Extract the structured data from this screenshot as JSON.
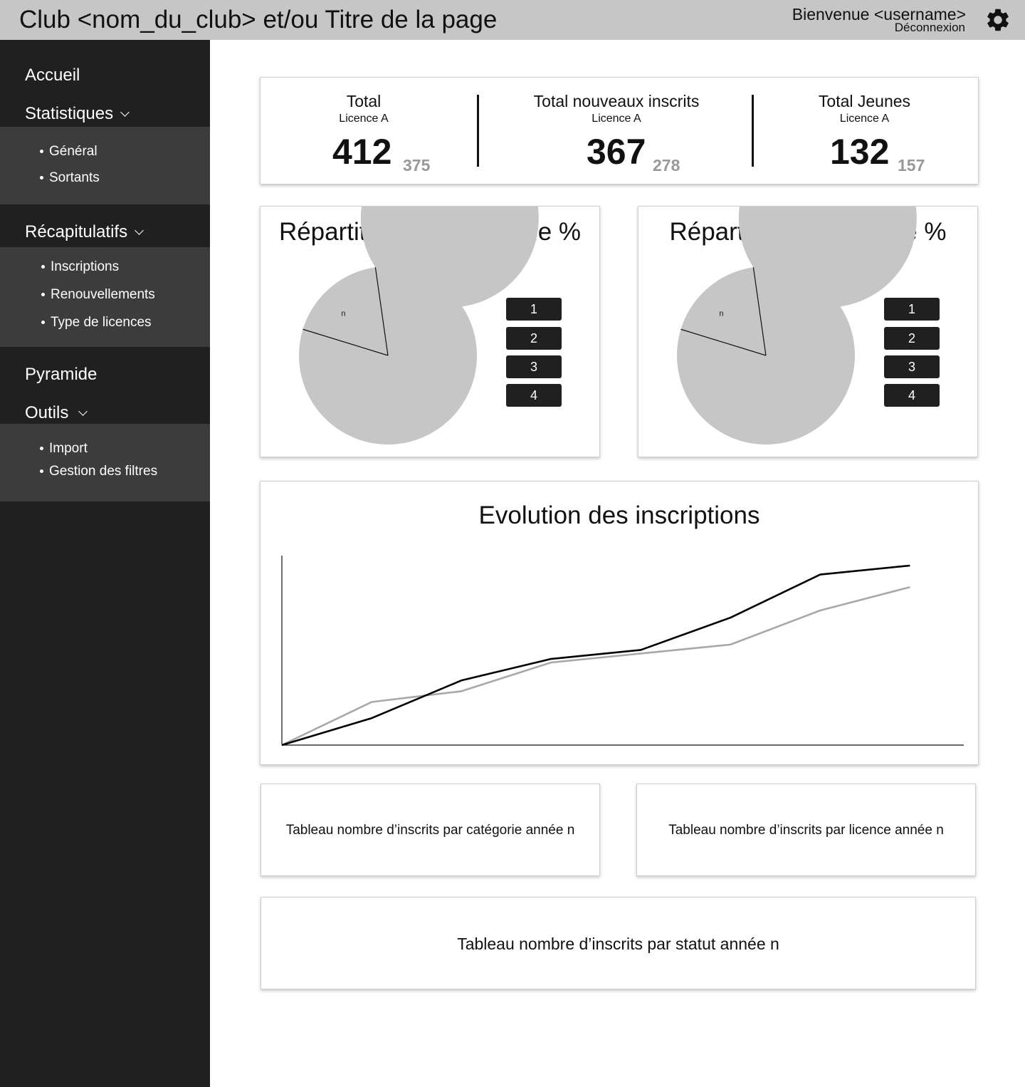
{
  "header": {
    "title": "Club <nom_du_club> et/ou Titre de la page",
    "welcome": "Bienvenue <username>",
    "logout": "Déconnexion",
    "settings_icon": "gear-icon"
  },
  "sidebar": {
    "home": "Accueil",
    "stats": {
      "label": "Statistiques",
      "items": [
        "Général",
        "Sortants"
      ]
    },
    "recaps": {
      "label": "Récapitulatifs",
      "items": [
        "Inscriptions",
        "Renouvellements",
        "Type de licences"
      ]
    },
    "pyramid": "Pyramide",
    "tools": {
      "label": "Outils",
      "items": [
        "Import",
        "Gestion des filtres"
      ]
    }
  },
  "kpis": [
    {
      "title": "Total",
      "subtitle": "Licence A",
      "value": "412",
      "previous": "375"
    },
    {
      "title": "Total nouveaux inscrits",
      "subtitle": "Licence A",
      "value": "367",
      "previous": "278"
    },
    {
      "title": "Total Jeunes",
      "subtitle": "Licence A",
      "value": "132",
      "previous": "157"
    }
  ],
  "pie_charts": [
    {
      "title": "Répartition par catégorie %",
      "slice_label": "n",
      "legend": [
        "1",
        "2",
        "3",
        "4"
      ]
    },
    {
      "title": "Répartition par licence %",
      "slice_label": "n",
      "legend": [
        "1",
        "2",
        "3",
        "4"
      ]
    }
  ],
  "colors": {
    "sidebar_bg": "#202020",
    "submenu_bg": "#3c3c3c",
    "topbar_bg": "#c6c6c6",
    "pie_fill": "#c6c6c6",
    "series_dark": "#000000",
    "series_light": "#a8a8a8"
  },
  "chart_data": [
    {
      "type": "pie",
      "title": "Répartition par catégorie %",
      "slices": [
        {
          "label": "n",
          "value": 0.18
        },
        {
          "label": "",
          "value": 0.82
        }
      ],
      "legend": [
        "1",
        "2",
        "3",
        "4"
      ]
    },
    {
      "type": "pie",
      "title": "Répartition par licence %",
      "slices": [
        {
          "label": "n",
          "value": 0.18
        },
        {
          "label": "",
          "value": 0.82
        }
      ],
      "legend": [
        "1",
        "2",
        "3",
        "4"
      ]
    },
    {
      "type": "line",
      "title": "Evolution des inscriptions",
      "xlabel": "",
      "ylabel": "",
      "x": [
        0,
        1,
        2,
        3,
        4,
        5,
        6,
        7
      ],
      "xlim": [
        0,
        7.6
      ],
      "ylim": [
        0,
        100
      ],
      "grid": false,
      "series": [
        {
          "values": [
            0,
            15,
            36,
            48,
            53,
            71,
            95,
            100
          ],
          "color": "#000000"
        },
        {
          "values": [
            0,
            24,
            30,
            46,
            51,
            56,
            75,
            88
          ],
          "color": "#a8a8a8"
        }
      ]
    }
  ],
  "tables": {
    "by_category": "Tableau nombre d’inscrits par catégorie année n",
    "by_licence": "Tableau nombre d’inscrits par licence année n",
    "by_status": "Tableau nombre d’inscrits par statut année n"
  }
}
